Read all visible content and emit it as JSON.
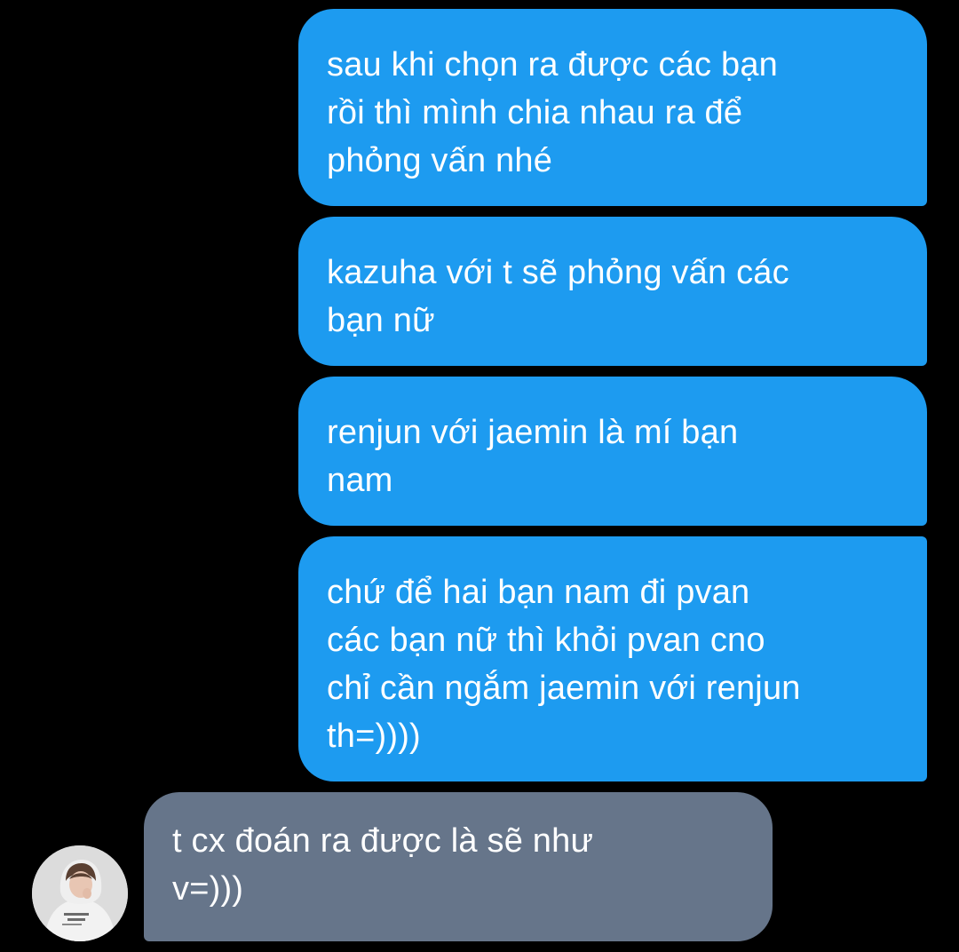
{
  "conversation": {
    "messages": [
      {
        "sender": "me",
        "text": "sau khi chọn ra được các bạn\nrồi thì mình chia nhau ra để\nphỏng vấn nhé"
      },
      {
        "sender": "me",
        "text": "kazuha với t sẽ phỏng vấn các\nbạn nữ"
      },
      {
        "sender": "me",
        "text": "renjun với jaemin là mí bạn\nnam"
      },
      {
        "sender": "me",
        "text": "chứ để hai bạn nam đi pvan\ncác bạn nữ thì khỏi pvan cno\nchỉ cần ngắm jaemin với renjun\nth=))))"
      },
      {
        "sender": "other",
        "text": "t cx đoán ra được là sẽ như\nv=)))"
      }
    ],
    "avatar": {
      "icon": "contact-avatar"
    }
  },
  "colors": {
    "background": "#000000",
    "outgoing_bubble": "#1d9bf0",
    "incoming_bubble": "#66758a",
    "text": "#ffffff"
  }
}
